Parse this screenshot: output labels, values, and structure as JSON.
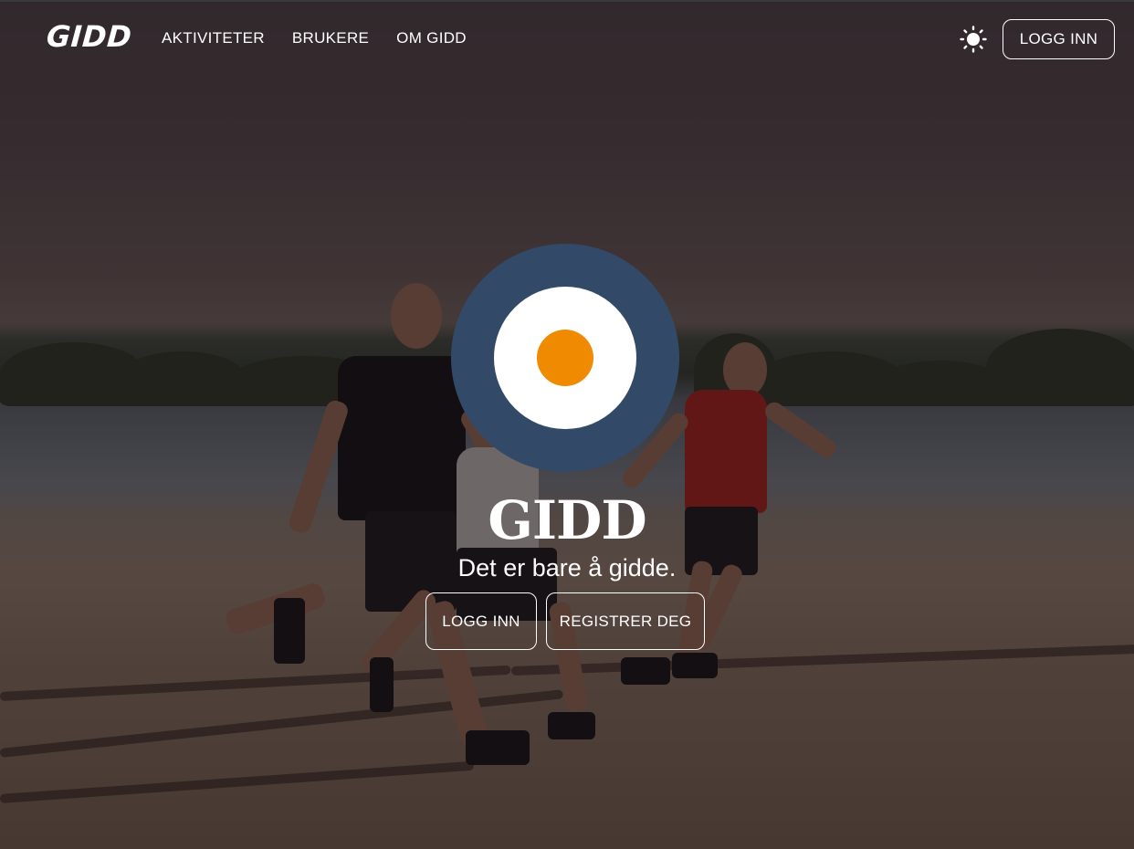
{
  "brand": {
    "name": "GIDD"
  },
  "nav": {
    "items": [
      {
        "label": "AKTIVITETER"
      },
      {
        "label": "BRUKERE"
      },
      {
        "label": "OM GIDD"
      }
    ],
    "theme_toggle_icon": "sun-icon",
    "login_label": "LOGG INN"
  },
  "hero": {
    "title": "GIDD",
    "tagline": "Det er bare å gidde.",
    "login_label": "LOGG INN",
    "register_label": "REGISTRER DEG",
    "background": "beach-runners-photo"
  },
  "colors": {
    "logo_navy": "#324a68",
    "logo_orange": "#f08a00",
    "text": "#ffffff",
    "overlay": "rgba(20,12,16,0.58)"
  }
}
